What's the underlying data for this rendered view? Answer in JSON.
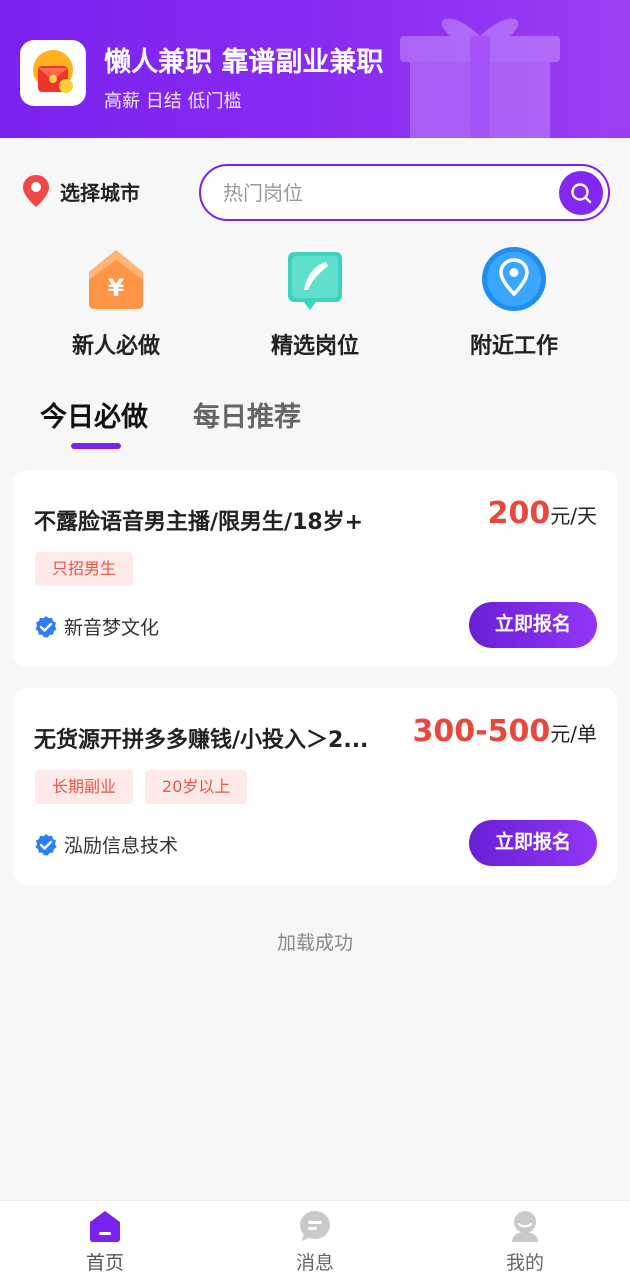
{
  "banner": {
    "title": "懒人兼职 靠谱副业兼职",
    "subtitle": "高薪 日结 低门槛"
  },
  "location": {
    "label": "选择城市"
  },
  "search": {
    "placeholder": "热门岗位",
    "value": ""
  },
  "quick_entries": [
    {
      "label": "新人必做",
      "icon": "yen-house-icon",
      "color": "#ff8a3d"
    },
    {
      "label": "精选岗位",
      "icon": "feather-book-icon",
      "color": "#3fd2bf"
    },
    {
      "label": "附近工作",
      "icon": "location-pin-icon",
      "color": "#1e8ff0"
    }
  ],
  "tabs": [
    {
      "label": "今日必做",
      "active": true
    },
    {
      "label": "每日推荐",
      "active": false
    }
  ],
  "jobs": [
    {
      "title": "不露脸语音男主播/限男生/18岁+",
      "salary": "200",
      "unit": "元/天",
      "tags": [
        "只招男生"
      ],
      "company": "新音梦文化",
      "apply_label": "立即报名"
    },
    {
      "title": "无货源开拼多多赚钱/小投入＞2...",
      "salary": "300-500",
      "unit": "元/单",
      "tags": [
        "长期副业",
        "20岁以上"
      ],
      "company": "泓励信息技术",
      "apply_label": "立即报名"
    }
  ],
  "load_status": "加载成功",
  "bottom_nav": [
    {
      "label": "首页",
      "icon": "home-icon",
      "active": true
    },
    {
      "label": "消息",
      "icon": "message-icon",
      "active": false
    },
    {
      "label": "我的",
      "icon": "profile-icon",
      "active": false
    }
  ],
  "colors": {
    "brand": "#7b22ee",
    "price": "#e8473c",
    "tag_bg": "#fde9e7",
    "tag_text": "#e8574c"
  }
}
